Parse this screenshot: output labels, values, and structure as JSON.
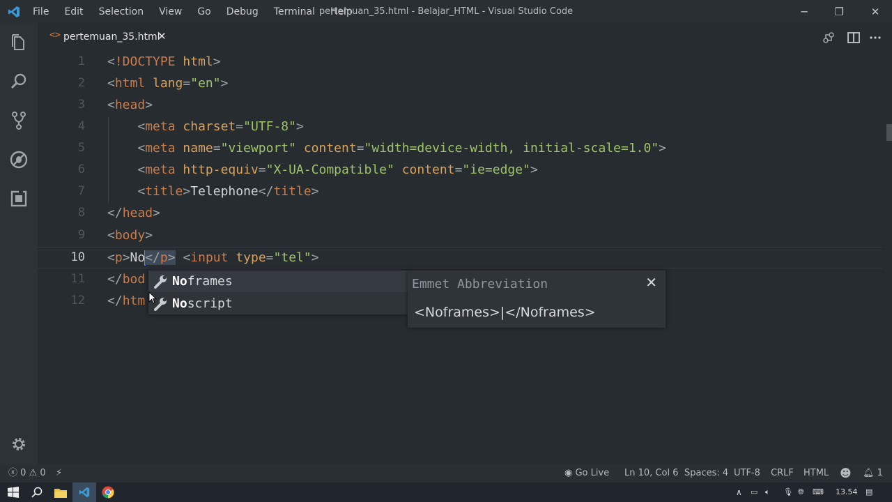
{
  "window": {
    "title": "pertemuan_35.html - Belajar_HTML - Visual Studio Code",
    "controls": {
      "minimize": "─",
      "maximize": "❐",
      "close": "✕"
    }
  },
  "menu": [
    "File",
    "Edit",
    "Selection",
    "View",
    "Go",
    "Debug",
    "Terminal",
    "Help"
  ],
  "activity_bar": [
    "explorer-icon",
    "search-icon",
    "source-control-icon",
    "debug-icon",
    "extensions-icon",
    "gear-icon"
  ],
  "tab": {
    "glyph": "<>",
    "label": "pertemuan_35.html",
    "close": "✕"
  },
  "editor_actions": [
    "open-changes-icon",
    "split-editor-icon",
    "more-actions-icon"
  ],
  "editor": {
    "active_line": 10,
    "lines": [
      {
        "n": "1",
        "text": "<!DOCTYPE html>"
      },
      {
        "n": "2",
        "text": "<html lang=\"en\">"
      },
      {
        "n": "3",
        "text": "<head>"
      },
      {
        "n": "4",
        "text": "    <meta charset=\"UTF-8\">"
      },
      {
        "n": "5",
        "text": "    <meta name=\"viewport\" content=\"width=device-width, initial-scale=1.0\">"
      },
      {
        "n": "6",
        "text": "    <meta http-equiv=\"X-UA-Compatible\" content=\"ie=edge\">"
      },
      {
        "n": "7",
        "text": "    <title>Telephone</title>"
      },
      {
        "n": "8",
        "text": "</head>"
      },
      {
        "n": "9",
        "text": "<body>"
      },
      {
        "n": "10",
        "text": "<p>No</p> <input type=\"tel\">"
      },
      {
        "n": "11",
        "text": "</bod"
      },
      {
        "n": "12",
        "text": "</htm"
      }
    ]
  },
  "suggest": {
    "items": [
      {
        "match": "No",
        "rest": "frames",
        "icon": "wrench-icon"
      },
      {
        "match": "No",
        "rest": "script",
        "icon": "wrench-icon"
      }
    ]
  },
  "details": {
    "title": "Emmet Abbreviation",
    "close": "✕",
    "body": "<Noframes>|</Noframes>"
  },
  "statusbar": {
    "errors": "0",
    "warnings": "0",
    "go_live": "Go Live",
    "position": "Ln 10, Col 6",
    "spaces": "Spaces: 4",
    "encoding": "UTF-8",
    "eol": "CRLF",
    "language": "HTML",
    "notifications": "1"
  },
  "taskbar": {
    "apps": [
      "start-icon",
      "search-icon",
      "file-explorer-icon",
      "vscode-icon",
      "chrome-icon"
    ],
    "clock": "13.54"
  },
  "colors": {
    "background": "#272c31",
    "tag": "#cc7b49",
    "attribute": "#d9a25a",
    "string": "#9fc46a",
    "cursor": "#528bff"
  }
}
